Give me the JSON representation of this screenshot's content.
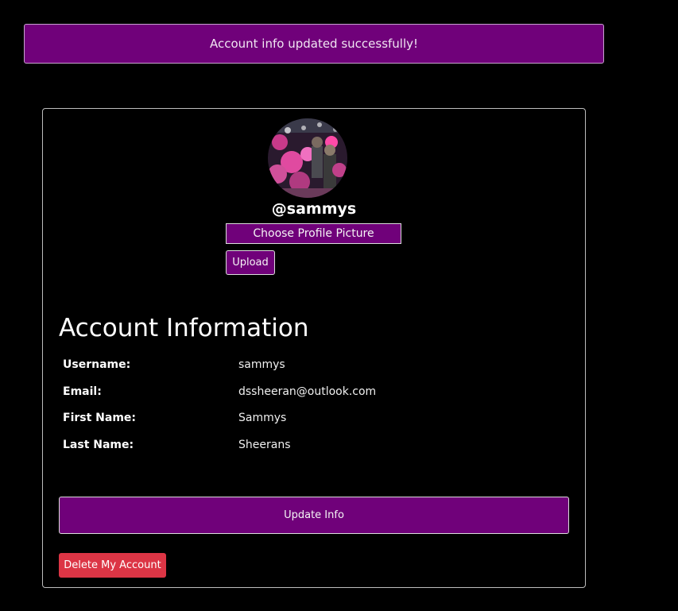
{
  "alert": {
    "message": "Account info updated successfully!"
  },
  "profile": {
    "handle": "@sammys",
    "avatar_alt": "profile picture",
    "choose_label": "Choose Profile Picture",
    "upload_label": "Upload"
  },
  "account": {
    "title": "Account Information",
    "rows": [
      {
        "label": "Username:",
        "value": "sammys"
      },
      {
        "label": "Email:",
        "value": "dssheeran@outlook.com"
      },
      {
        "label": "First Name:",
        "value": "Sammys"
      },
      {
        "label": "Last Name:",
        "value": "Sheerans"
      }
    ],
    "update_label": "Update Info",
    "delete_label": "Delete My Account"
  },
  "colors": {
    "accent": "#70017a",
    "danger": "#dc3545",
    "background": "#000000"
  }
}
